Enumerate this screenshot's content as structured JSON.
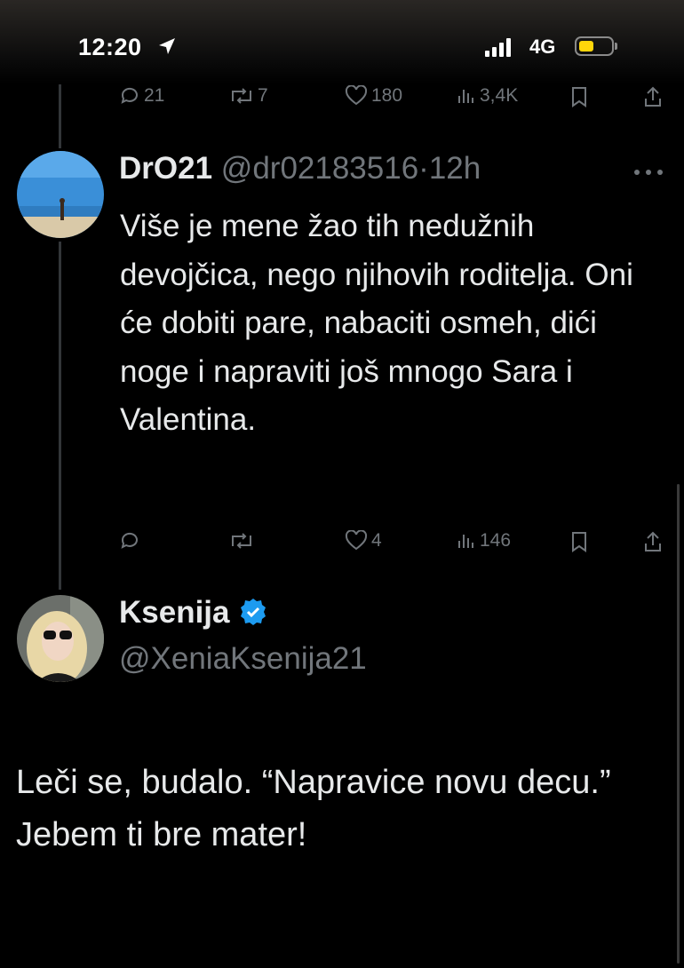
{
  "status_bar": {
    "time": "12:20",
    "network": "4G",
    "location_icon": "location-arrow-icon",
    "battery_color": "#ffd60a"
  },
  "prev_tweet_actions": {
    "replies": "21",
    "reposts": "7",
    "likes": "180",
    "views": "3,4K"
  },
  "tweet": {
    "display_name": "DrO21",
    "handle": "@dr02183516",
    "separator": "·",
    "time": "12h",
    "text": "Više je mene žao tih nedužnih devojčica, nego njihovih roditelja. Oni će dobiti pare, nabaciti osmeh, dići noge i napraviti još mnogo Sara i Valentina.",
    "actions": {
      "replies": "",
      "reposts": "",
      "likes": "4",
      "views": "146"
    }
  },
  "reply": {
    "display_name": "Ksenija",
    "handle": "@XeniaKsenija21",
    "verified_color": "#1d9bf0",
    "text": "Leči se, budalo. “Napravice novu decu.”\nJebem ti bre mater!"
  },
  "colors": {
    "muted": "#71767b",
    "text": "#e7e9ea",
    "background": "#000000"
  }
}
